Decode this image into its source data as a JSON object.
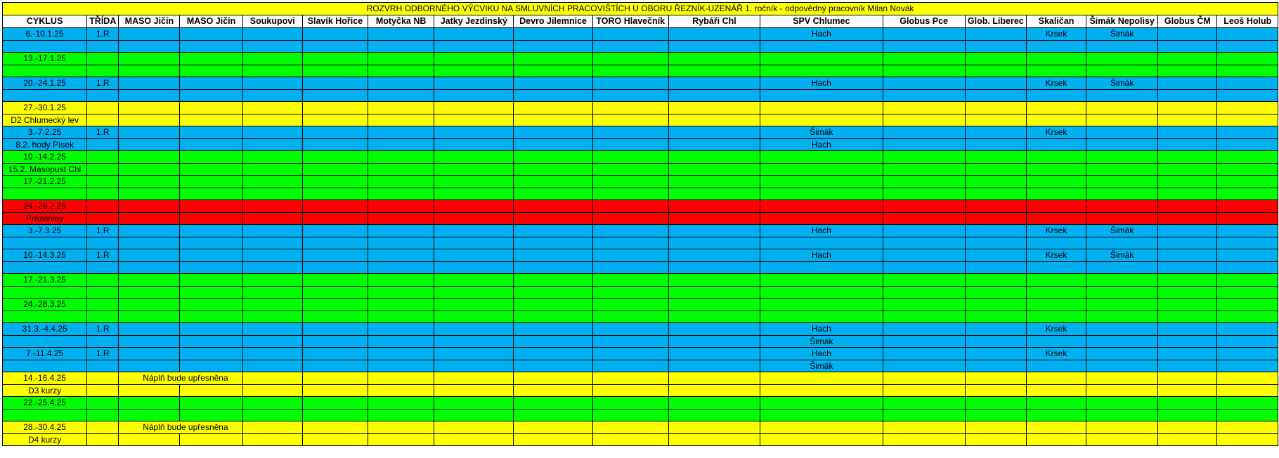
{
  "title": "ROZVRH ODBORNÉHO VÝCVIKU NA SMLUVNÍCH PRACOVIŠTÍCH U OBORU ŘEZNÍK-UZENÁŘ  1. ročník - odpovědný pracovník Milan Novák",
  "columns": [
    "CYKLUS",
    "TŘÍDA",
    "MASO Jičín",
    "MASO Jičín",
    "Soukupovi",
    "Slavík Hořice",
    "Motyčka NB",
    "Jatky Jezdinský",
    "Devro Jilemnice",
    "TORO Hlavečník",
    "Rybáři Chl",
    "SPV Chlumec",
    "Globus Pce",
    "Glob. Liberec",
    "Skaličan",
    "Šimák Nepolisy",
    "Globus ČM",
    "Leoš Holub"
  ],
  "cycles": [
    {
      "color": "blue",
      "rows": [
        [
          "6.-10.1.25",
          "1.R",
          "",
          "",
          "",
          "",
          "",
          "",
          "",
          "",
          "",
          "Hach",
          "",
          "",
          "Krsek",
          "Šimák",
          "",
          ""
        ],
        [
          "",
          "",
          "",
          "",
          "",
          "",
          "",
          "",
          "",
          "",
          "",
          "",
          "",
          "",
          "",
          "",
          "",
          ""
        ]
      ]
    },
    {
      "color": "green",
      "rows": [
        [
          "13.-17.1.25",
          "",
          "",
          "",
          "",
          "",
          "",
          "",
          "",
          "",
          "",
          "",
          "",
          "",
          "",
          "",
          "",
          ""
        ],
        [
          "",
          "",
          "",
          "",
          "",
          "",
          "",
          "",
          "",
          "",
          "",
          "",
          "",
          "",
          "",
          "",
          "",
          ""
        ]
      ]
    },
    {
      "color": "blue",
      "rows": [
        [
          "20.-24.1.25",
          "1.R",
          "",
          "",
          "",
          "",
          "",
          "",
          "",
          "",
          "",
          "Hach",
          "",
          "",
          "Krsek",
          "Šimák",
          "",
          ""
        ],
        [
          "",
          "",
          "",
          "",
          "",
          "",
          "",
          "",
          "",
          "",
          "",
          "",
          "",
          "",
          "",
          "",
          "",
          ""
        ]
      ]
    },
    {
      "color": "yellow",
      "rows": [
        [
          "27.-30.1.25",
          "",
          "",
          "",
          "",
          "",
          "",
          "",
          "",
          "",
          "",
          "",
          "",
          "",
          "",
          "",
          "",
          ""
        ],
        [
          "D2 Chlumecký lev",
          "",
          "",
          "",
          "",
          "",
          "",
          "",
          "",
          "",
          "",
          "",
          "",
          "",
          "",
          "",
          "",
          ""
        ]
      ]
    },
    {
      "color": "blue",
      "rows": [
        [
          "3.-7.2.25",
          "1.R",
          "",
          "",
          "",
          "",
          "",
          "",
          "",
          "",
          "",
          "Šimák",
          "",
          "",
          "Krsek",
          "",
          "",
          ""
        ],
        [
          "8.2. hody Písek",
          "",
          "",
          "",
          "",
          "",
          "",
          "",
          "",
          "",
          "",
          "Hach",
          "",
          "",
          "",
          "",
          "",
          ""
        ]
      ]
    },
    {
      "color": "green",
      "rows": [
        [
          "10.-14.2.25",
          "",
          "",
          "",
          "",
          "",
          "",
          "",
          "",
          "",
          "",
          "",
          "",
          "",
          "",
          "",
          "",
          ""
        ],
        [
          "15.2. Masopust Chl",
          "",
          "",
          "",
          "",
          "",
          "",
          "",
          "",
          "",
          "",
          "",
          "",
          "",
          "",
          "",
          "",
          ""
        ]
      ]
    },
    {
      "color": "green",
      "rows": [
        [
          "17.-21.2.25",
          "",
          "",
          "",
          "",
          "",
          "",
          "",
          "",
          "",
          "",
          "",
          "",
          "",
          "",
          "",
          "",
          ""
        ],
        [
          "",
          "",
          "",
          "",
          "",
          "",
          "",
          "",
          "",
          "",
          "",
          "",
          "",
          "",
          "",
          "",
          "",
          ""
        ]
      ]
    },
    {
      "color": "red",
      "rows": [
        [
          "24.-28.2.25",
          "",
          "",
          "",
          "",
          "",
          "",
          "",
          "",
          "",
          "",
          "",
          "",
          "",
          "",
          "",
          "",
          ""
        ],
        [
          "Prázdniny",
          "",
          "",
          "",
          "",
          "",
          "",
          "",
          "",
          "",
          "",
          "",
          "",
          "",
          "",
          "",
          "",
          ""
        ]
      ]
    },
    {
      "color": "blue",
      "rows": [
        [
          "3.-7.3.25",
          "1.R",
          "",
          "",
          "",
          "",
          "",
          "",
          "",
          "",
          "",
          "Hach",
          "",
          "",
          "Krsek",
          "Šimák",
          "",
          ""
        ],
        [
          "",
          "",
          "",
          "",
          "",
          "",
          "",
          "",
          "",
          "",
          "",
          "",
          "",
          "",
          "",
          "",
          "",
          ""
        ]
      ]
    },
    {
      "color": "blue",
      "rows": [
        [
          "10.-14.3.25",
          "1.R",
          "",
          "",
          "",
          "",
          "",
          "",
          "",
          "",
          "",
          "Hach",
          "",
          "",
          "Krsek",
          "Šimák",
          "",
          ""
        ],
        [
          "",
          "",
          "",
          "",
          "",
          "",
          "",
          "",
          "",
          "",
          "",
          "",
          "",
          "",
          "",
          "",
          "",
          ""
        ]
      ]
    },
    {
      "color": "green",
      "rows": [
        [
          "17.-21.3.25",
          "",
          "",
          "",
          "",
          "",
          "",
          "",
          "",
          "",
          "",
          "",
          "",
          "",
          "",
          "",
          "",
          ""
        ],
        [
          "",
          "",
          "",
          "",
          "",
          "",
          "",
          "",
          "",
          "",
          "",
          "",
          "",
          "",
          "",
          "",
          "",
          ""
        ]
      ]
    },
    {
      "color": "green",
      "rows": [
        [
          "24.-28.3.25",
          "",
          "",
          "",
          "",
          "",
          "",
          "",
          "",
          "",
          "",
          "",
          "",
          "",
          "",
          "",
          "",
          ""
        ],
        [
          "",
          "",
          "",
          "",
          "",
          "",
          "",
          "",
          "",
          "",
          "",
          "",
          "",
          "",
          "",
          "",
          "",
          ""
        ]
      ]
    },
    {
      "color": "blue",
      "rows": [
        [
          "31.3.-4.4.25",
          "1.R",
          "",
          "",
          "",
          "",
          "",
          "",
          "",
          "",
          "",
          "Hach",
          "",
          "",
          "Krsek",
          "",
          "",
          ""
        ],
        [
          "",
          "",
          "",
          "",
          "",
          "",
          "",
          "",
          "",
          "",
          "",
          "Šimák",
          "",
          "",
          "",
          "",
          "",
          ""
        ]
      ]
    },
    {
      "color": "blue",
      "rows": [
        [
          "7.-11.4.25",
          "1.R",
          "",
          "",
          "",
          "",
          "",
          "",
          "",
          "",
          "",
          "Hach",
          "",
          "",
          "Krsek",
          "",
          "",
          ""
        ],
        [
          "",
          "",
          "",
          "",
          "",
          "",
          "",
          "",
          "",
          "",
          "",
          "Šimák",
          "",
          "",
          "",
          "",
          "",
          ""
        ]
      ]
    },
    {
      "color": "yellow",
      "rows": [
        [
          "14.-16.4.25",
          "",
          "Náplň bude upřesněna",
          "",
          "",
          "",
          "",
          "",
          "",
          "",
          "",
          "",
          "",
          "",
          "",
          "",
          "",
          ""
        ],
        [
          "D3 kurzy",
          "",
          "",
          "",
          "",
          "",
          "",
          "",
          "",
          "",
          "",
          "",
          "",
          "",
          "",
          "",
          "",
          ""
        ]
      ]
    },
    {
      "color": "green",
      "rows": [
        [
          "22.-25.4.25",
          "",
          "",
          "",
          "",
          "",
          "",
          "",
          "",
          "",
          "",
          "",
          "",
          "",
          "",
          "",
          "",
          ""
        ],
        [
          "",
          "",
          "",
          "",
          "",
          "",
          "",
          "",
          "",
          "",
          "",
          "",
          "",
          "",
          "",
          "",
          "",
          ""
        ]
      ]
    },
    {
      "color": "yellow",
      "rows": [
        [
          "28.-30.4.25",
          "",
          "Náplň bude upřesněna",
          "",
          "",
          "",
          "",
          "",
          "",
          "",
          "",
          "",
          "",
          "",
          "",
          "",
          "",
          ""
        ],
        [
          "D4 kurzy",
          "",
          "",
          "",
          "",
          "",
          "",
          "",
          "",
          "",
          "",
          "",
          "",
          "",
          "",
          "",
          "",
          ""
        ]
      ]
    }
  ],
  "colors": {
    "blue": "#00b0f0",
    "green": "#00ff00",
    "yellow": "#ffff00",
    "red": "#ff0000"
  }
}
